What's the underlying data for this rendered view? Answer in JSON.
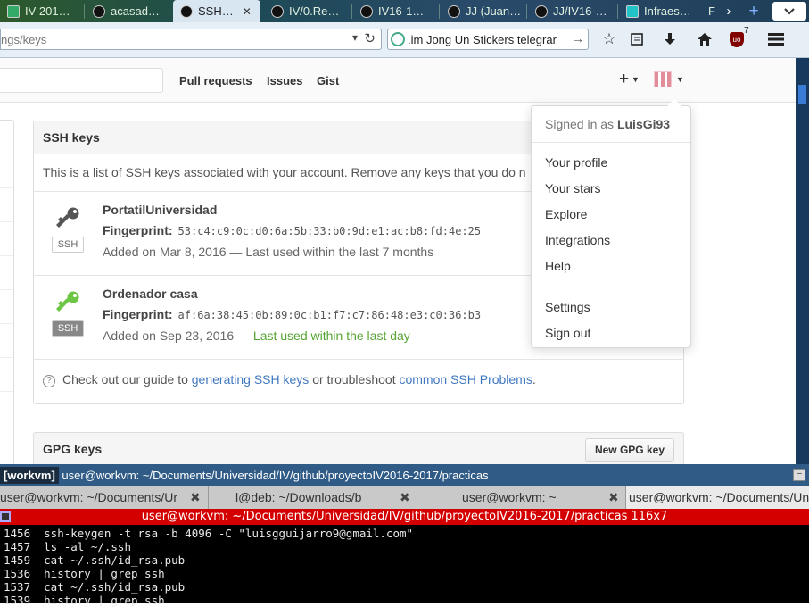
{
  "browser": {
    "tabs": [
      {
        "label": "IV-201…"
      },
      {
        "label": "acasad…"
      },
      {
        "label": "SSH…",
        "close": "✕"
      },
      {
        "label": "IV/0.Re…"
      },
      {
        "label": "IV16-1…"
      },
      {
        "label": "JJ (Juan…"
      },
      {
        "label": "JJ/IV16-…"
      },
      {
        "label": "Infraes…"
      },
      {
        "label": "F"
      }
    ],
    "tab_more": "›",
    "tab_new": "+",
    "url": "ngs/keys",
    "search": ".im Jong Un Stickers telegrar",
    "ublock_count": "7"
  },
  "github": {
    "nav": [
      "Pull requests",
      "Issues",
      "Gist"
    ],
    "new_menu": "+",
    "ssh_panel": {
      "title": "SSH keys",
      "intro": "This is a list of SSH keys associated with your account. Remove any keys that you do n",
      "keys": [
        {
          "title": "PortatilUniversidad",
          "fp_label": "Fingerprint:",
          "fingerprint": "53:c4:c9:0c:d0:6a:5b:33:b0:9d:e1:ac:b8:fd:4e:25",
          "added": "Added on Mar 8, 2016 — Last used within the last 7 months",
          "badge": "SSH",
          "icon_color": "#555555"
        },
        {
          "title": "Ordenador casa",
          "fp_label": "Fingerprint:",
          "fingerprint": "af:6a:38:45:0b:89:0c:b1:f7:c7:86:48:e3:c0:36:b3",
          "added": "Added on Sep 23, 2016 — ",
          "added_recent": "Last used within the last day",
          "badge": "SSH",
          "icon_color": "#6cc644"
        }
      ],
      "footer": {
        "pre": "Check out our guide to",
        "link1": "generating SSH keys",
        "mid": "or troubleshoot",
        "link2": "common SSH Problems",
        "post": "."
      }
    },
    "gpg_panel": {
      "title": "GPG keys",
      "button": "New GPG key"
    },
    "dropdown": {
      "signed_in_prefix": "Signed in as",
      "username": "LuisGi93",
      "items_a": [
        "Your profile",
        "Your stars",
        "Explore",
        "Integrations",
        "Help"
      ],
      "items_b": [
        "Settings",
        "Sign out"
      ]
    }
  },
  "terminal": {
    "window_tag": "[workvm]",
    "window_title": "user@workvm: ~/Documents/Universidad/IV/github/proyectoIV2016-2017/practicas",
    "tabs": [
      "user@workvm: ~/Documents/Ur",
      "l@deb: ~/Downloads/b",
      "user@workvm: ~",
      "user@workvm: ~/Documents/Un"
    ],
    "tab_close": "✖",
    "status": "user@workvm: ~/Documents/Universidad/IV/github/proyectoIV2016-2017/practicas 116x7",
    "lines": [
      "1456  ssh-keygen -t rsa -b 4096 -C \"luisgguijarro9@gmail.com\"",
      "1457  ls -al ~/.ssh",
      "1459  cat ~/.ssh/id_rsa.pub",
      "1536  history | grep ssh",
      "1537  cat ~/.ssh/id_rsa.pub",
      "1539  history | grep ssh"
    ]
  }
}
